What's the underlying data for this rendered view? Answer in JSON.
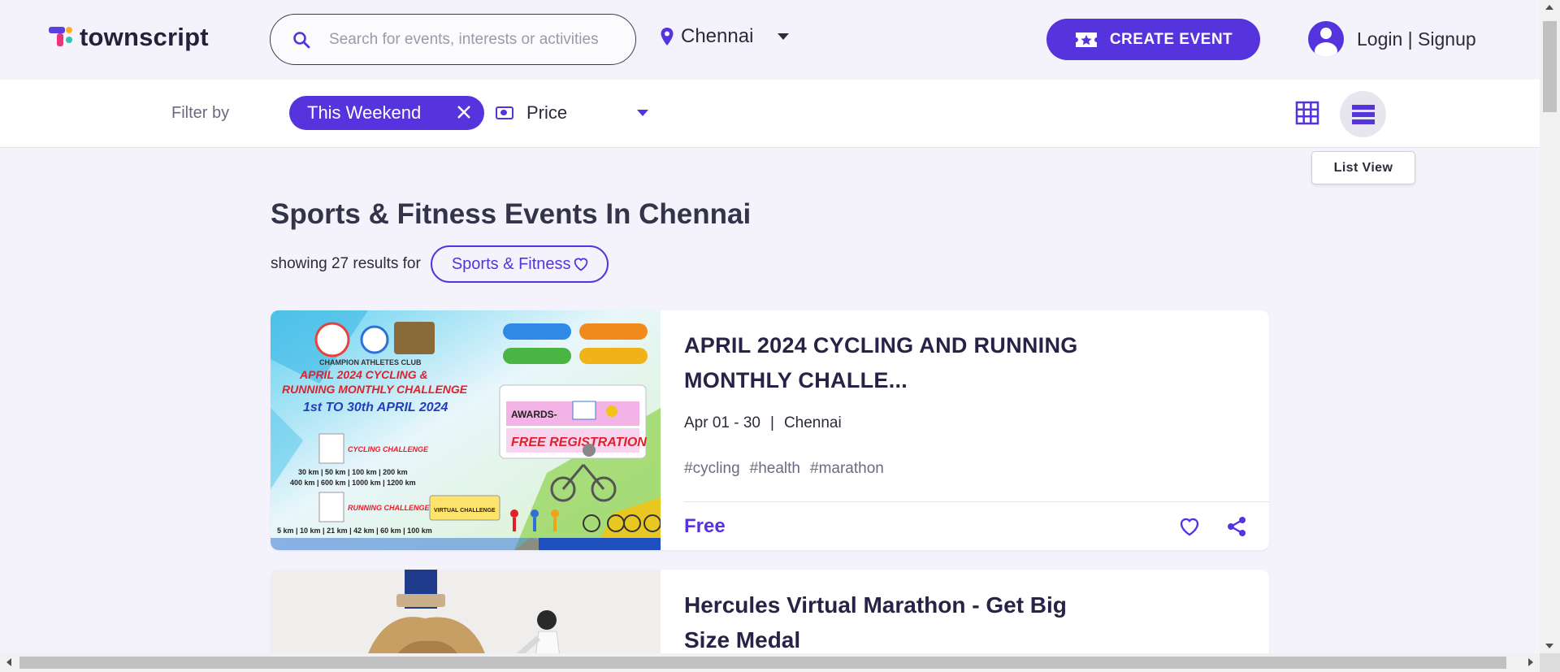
{
  "header": {
    "brand": "townscript",
    "search_placeholder": "Search for events, interests or activities",
    "city": "Chennai",
    "create_event_label": "CREATE EVENT",
    "login_label": "Login | Signup"
  },
  "filters": {
    "label": "Filter by",
    "active_chip": "This Weekend",
    "price_label": "Price",
    "view_tooltip": "List View"
  },
  "main": {
    "title": "Sports & Fitness Events In Chennai",
    "results_text": "showing 27 results for",
    "category_chip": "Sports & Fitness"
  },
  "events": [
    {
      "title": "APRIL 2024 CYCLING AND RUNNING MONTHLY CHALLE...",
      "date": "Apr 01 - 30",
      "separator": "|",
      "location": "Chennai",
      "tags": [
        "#cycling",
        "#health",
        "#marathon"
      ],
      "price": "Free",
      "poster": {
        "club": "CHAMPION ATHLETES CLUB",
        "line1": "APRIL 2024 CYCLING &",
        "line2": "RUNNING MONTHLY CHALLENGE",
        "dates": "1st TO 30th APRIL 2024",
        "cycling": "CYCLING CHALLENGE",
        "running": "RUNNING CHALLENGE",
        "virtual": "VIRTUAL CHALLENGE",
        "awards": "AWARDS-",
        "free_reg": "FREE REGISTRATION",
        "cyc_dist1": "30 km | 50 km | 100 km | 200 km",
        "cyc_dist2": "400 km | 600 km | 1000 km | 1200 km",
        "run_dist": "5 km | 10 km | 21 km | 42 km | 60 km | 100 km"
      }
    },
    {
      "title": "Hercules Virtual Marathon - Get Big Size Medal"
    }
  ],
  "colors": {
    "accent": "#5533dd",
    "page_bg": "#f4f3fb",
    "card_bg": "#ffffff",
    "title_text": "#2a2246"
  }
}
